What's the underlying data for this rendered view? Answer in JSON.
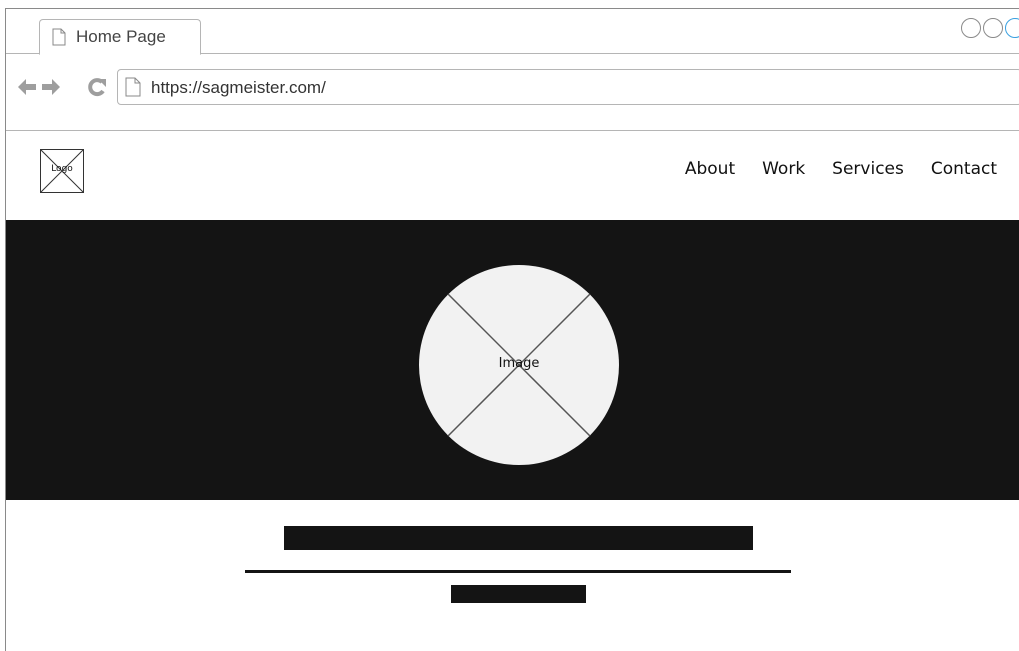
{
  "browser": {
    "tab_title": "Home Page",
    "url": "https://sagmeister.com/",
    "icons": {
      "back": "back-arrow-icon",
      "forward": "forward-arrow-icon",
      "reload": "reload-icon",
      "page": "page-icon"
    },
    "window_controls": [
      "minimize-circle",
      "maximize-circle",
      "close-circle"
    ]
  },
  "site": {
    "logo_label": "Logo",
    "nav": {
      "about": "About",
      "work": "Work",
      "services": "Services",
      "contact": "Contact"
    },
    "hero": {
      "image_label": "Image",
      "background": "#141414"
    }
  },
  "colors": {
    "dark": "#141414",
    "placeholder_fill": "#f2f2f2",
    "control_gray": "#9e9e9e",
    "accent_blue": "#3aa0e0"
  }
}
